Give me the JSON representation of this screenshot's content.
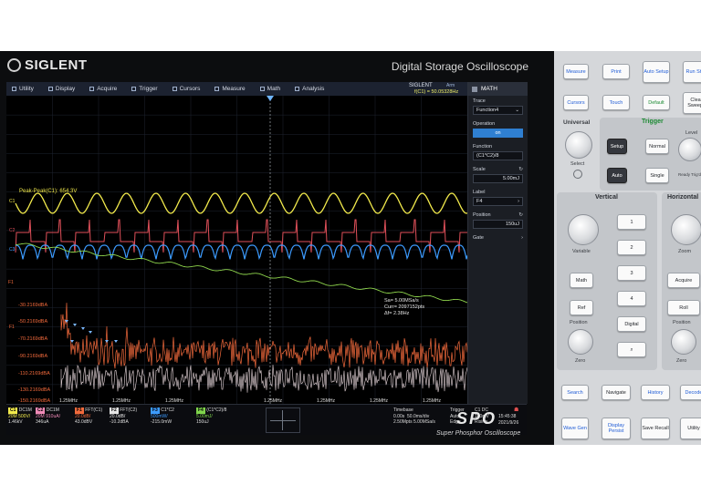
{
  "brand": {
    "logo": "SIGLENT",
    "product_title": "Digital Storage Oscilloscope",
    "series": "SPO",
    "series_subtitle": "Super Phosphor Oscilloscope"
  },
  "menu": {
    "items": [
      {
        "label": "Utility",
        "icon": "utility-icon"
      },
      {
        "label": "Display",
        "icon": "display-icon"
      },
      {
        "label": "Acquire",
        "icon": "acquire-icon"
      },
      {
        "label": "Trigger",
        "icon": "trigger-icon"
      },
      {
        "label": "Cursors",
        "icon": "cursors-icon"
      },
      {
        "label": "Measure",
        "icon": "measure-icon"
      },
      {
        "label": "Math",
        "icon": "math-icon"
      },
      {
        "label": "Analysis",
        "icon": "analysis-icon"
      }
    ],
    "brand": "SIGLENT",
    "state": "Arm",
    "trigger_readout": "f(C1) = 50.05328Hz"
  },
  "waveform": {
    "peak_label": "Peak-Peak(C1): 654.3V",
    "ch1_label": "C1",
    "ch2_label": "C2",
    "ch3_label": "C3",
    "ch4_label": "F1",
    "fft_levels": [
      "-30.2169dBA",
      "-50.2169dBA",
      "-70.2169dBA",
      "-90.2169dBA",
      "-110.2169dBA",
      "-130.2169dBA",
      "-150.2169dBA"
    ],
    "fft_freqs": [
      "1.25MHz",
      "1.25MHz",
      "1.25MHz",
      "1.25MHz",
      "1.25MHz",
      "1.25MHz",
      "1.25MHz"
    ],
    "fft_info": [
      "Sa= 5.00MSa/s",
      "Curr= 2097152pts",
      "Δf= 2.38Hz"
    ],
    "fft_side_label": "F1"
  },
  "math_panel": {
    "title": "MATH",
    "trace_label": "Trace",
    "trace_value": "Function4",
    "operation_label": "Operation",
    "operation_value": "on",
    "function_label": "Function",
    "function_value": "(C1*C2)/8",
    "scale_label": "Scale",
    "scale_value": "5.00mJ",
    "label_label": "Label",
    "label_value": "F4",
    "position_label": "Position",
    "position_value": "150uJ",
    "gate_label": "Gate"
  },
  "status": {
    "channels": [
      {
        "tag": "C1",
        "head": "DC1M",
        "v1": "500V/",
        "v2": "1.46kV",
        "pre": "20M",
        "color": "#f2ea4c"
      },
      {
        "tag": "C2",
        "head": "DC1M",
        "v1": "910uA/",
        "v2": "346uA",
        "pre": "20M",
        "color": "#f08ab7"
      },
      {
        "tag": "F1",
        "head": "FFT(C1)",
        "v1": "20.0dB/",
        "v2": "43.0dBV",
        "pre": "",
        "color": "#f26a3c"
      },
      {
        "tag": "F2",
        "head": "FFT(C2)",
        "v1": "20.0dB/",
        "v2": "-10.2dBA",
        "pre": "",
        "color": "#e6e6e6"
      },
      {
        "tag": "F3",
        "head": "C1*C2",
        "v1": "500mW/",
        "v2": "-215.0mW",
        "pre": "",
        "color": "#3c9bff"
      },
      {
        "tag": "F4",
        "head": "(C1*C2)/8",
        "v1": "5.00mJ/",
        "v2": "150uJ",
        "pre": "",
        "color": "#7fd44c"
      }
    ],
    "timebase": {
      "label": "Timebase",
      "offset": "0.00s",
      "scale": "50.0ms/div",
      "pts": "2.50Mpts",
      "rate": "5.00MSa/s"
    },
    "trigger": {
      "label": "Trigger",
      "source": "C1 DC",
      "mode": "Auto",
      "level": "140mV",
      "type": "Edge",
      "slope": "Rising"
    },
    "clock": {
      "time": "15:45:38",
      "date": "2021/9/26"
    }
  },
  "panel": {
    "measure": "Measure",
    "print": "Print",
    "auto_setup": "Auto Setup",
    "run_stop": "Run Stop",
    "cursors": "Cursors",
    "touch": "Touch",
    "default": "Default",
    "clear_sweeps": "Clear Sweeps",
    "universal": "Universal",
    "select": "Select",
    "trigger_title": "Trigger",
    "setup": "Setup",
    "normal": "Normal",
    "auto": "Auto",
    "single": "Single",
    "level": "Level",
    "ready": "Ready",
    "trigd": "Trig'd",
    "vertical_title": "Vertical",
    "horizontal_title": "Horizontal",
    "variable": "Variable",
    "zoom": "Zoom",
    "ch_buttons": [
      "1",
      "2",
      "3",
      "4"
    ],
    "math": "Math",
    "acquire": "Acquire",
    "ref": "Ref",
    "roll": "Roll",
    "digital": "Digital",
    "position": "Position",
    "zero": "Zero",
    "search": "Search",
    "navigate": "Navigate",
    "history": "History",
    "decode": "Decode",
    "wave_gen": "Wave Gen",
    "display_persist": "Display Persist",
    "save_recall": "Save Recall",
    "utility": "Utility"
  },
  "colors": {
    "ch1": "#f2ea4c",
    "ch2": "#e0505a",
    "ch3": "#3c9bff",
    "math4": "#8ed44c",
    "fft1": "#f26a3c",
    "fft2": "#e8d8dc"
  }
}
